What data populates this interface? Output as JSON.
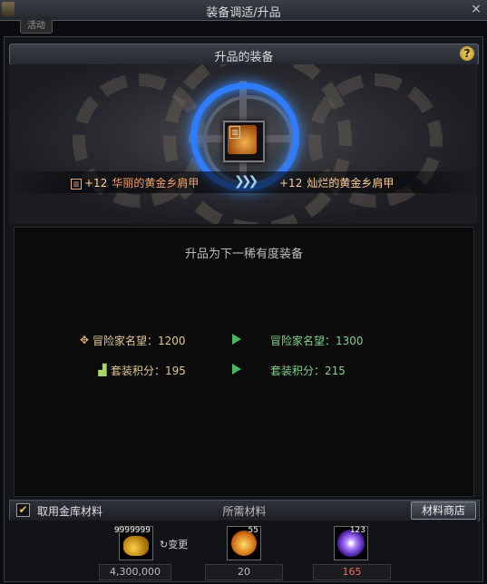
{
  "window": {
    "title": "装备调适/升品",
    "close_glyph": "×",
    "activity_tab": "活动"
  },
  "section": {
    "title": "升品的装备",
    "help_glyph": "?"
  },
  "upgrade": {
    "source_plus": "+12",
    "source_name": "华丽的黄金乡肩甲",
    "arrows": "❯❯❯",
    "target_plus": "+12",
    "target_name": "灿烂的黄金乡肩甲",
    "lock_icon": "lock-icon"
  },
  "info": {
    "headline": "升品为下一稀有度装备",
    "rows": [
      {
        "icon": "reputation-icon",
        "label": "冒险家名望：1200",
        "result": "冒险家名望：1300"
      },
      {
        "icon": "set-points-icon",
        "label": "套装积分：195",
        "result": "套装积分：215"
      }
    ]
  },
  "bottom": {
    "checkbox_label": "取用金库材料",
    "checked": true,
    "required_label": "所需材料",
    "shop_button": "材料商店"
  },
  "materials": [
    {
      "name": "gold-coins",
      "badge": "9999999",
      "amount": "4,300,000",
      "amount_color": "#bdbdbd"
    },
    {
      "name": "amber-orb",
      "badge": "55",
      "amount": "20",
      "amount_color": "#bdbdbd"
    },
    {
      "name": "void-orb",
      "badge": "123",
      "amount": "165",
      "amount_color": "#ff6464"
    }
  ],
  "change_label": "↻变更"
}
